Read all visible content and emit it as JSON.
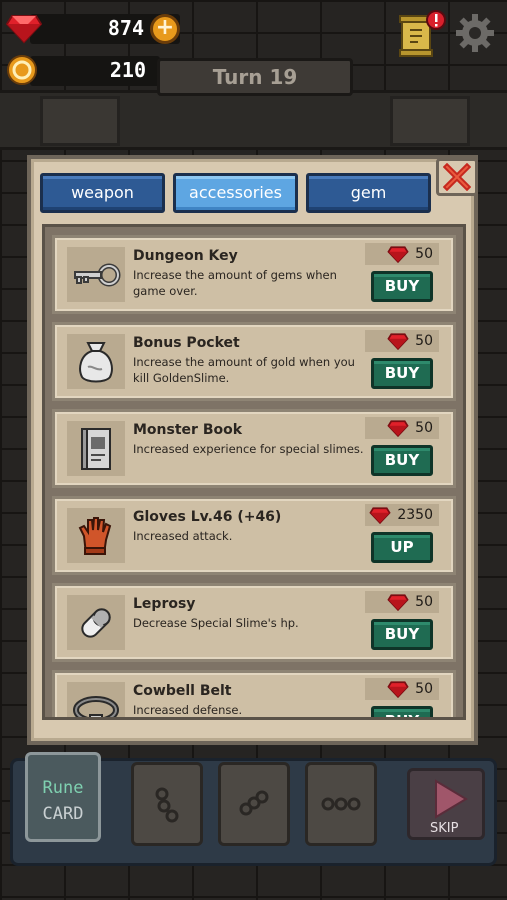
{
  "hud": {
    "gems": "874",
    "gold": "210",
    "turn": "Turn 19"
  },
  "tabs": [
    {
      "label": "weapon",
      "active": false
    },
    {
      "label": "accessories",
      "active": true
    },
    {
      "label": "gem",
      "active": false
    }
  ],
  "items": [
    {
      "name": "Dungeon Key",
      "desc": "Increase the amount of gems when game over.",
      "price": "50",
      "action": "BUY",
      "icon": "key-icon"
    },
    {
      "name": "Bonus Pocket",
      "desc": "Increase the amount of gold when you kill GoldenSlime.",
      "price": "50",
      "action": "BUY",
      "icon": "pouch-icon"
    },
    {
      "name": "Monster Book",
      "desc": "Increased experience for special slimes.",
      "price": "50",
      "action": "BUY",
      "icon": "book-icon"
    },
    {
      "name": "Gloves Lv.46 (+46)",
      "desc": "Increased attack.",
      "price": "2350",
      "action": "UP",
      "icon": "glove-icon"
    },
    {
      "name": "Leprosy",
      "desc": "Decrease Special Slime's hp.",
      "price": "50",
      "action": "BUY",
      "icon": "pill-icon"
    },
    {
      "name": "Cowbell Belt",
      "desc": "Increased defense.",
      "price": "50",
      "action": "BUY",
      "icon": "belt-icon"
    }
  ],
  "bottom": {
    "rune_card_line1": "Rune",
    "rune_card_line2": "CARD",
    "skip_label": "SKIP"
  },
  "colors": {
    "gem_red": "#e0202a",
    "tab_blue": "#2e5a94",
    "tab_active": "#5ea6e2",
    "buy_green": "#1f6b52"
  }
}
